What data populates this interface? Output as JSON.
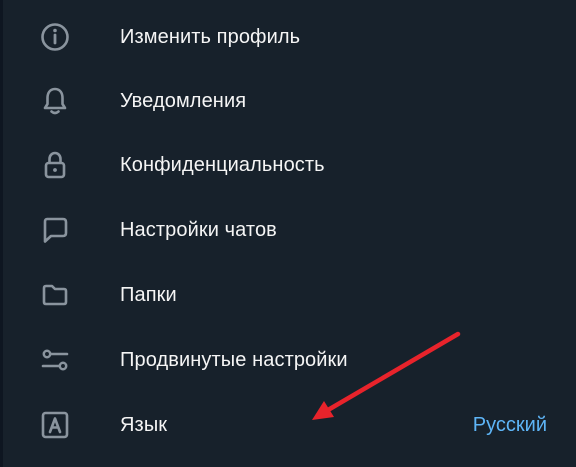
{
  "menu": {
    "items": [
      {
        "id": "edit-profile",
        "label": "Изменить профиль",
        "icon": "info-icon"
      },
      {
        "id": "notifications",
        "label": "Уведомления",
        "icon": "bell-icon"
      },
      {
        "id": "privacy",
        "label": "Конфиденциальность",
        "icon": "lock-icon"
      },
      {
        "id": "chat-settings",
        "label": "Настройки чатов",
        "icon": "chat-bubble-icon"
      },
      {
        "id": "folders",
        "label": "Папки",
        "icon": "folder-icon"
      },
      {
        "id": "advanced",
        "label": "Продвинутые настройки",
        "icon": "sliders-icon"
      },
      {
        "id": "language",
        "label": "Язык",
        "icon": "language-icon",
        "value": "Русский"
      }
    ]
  },
  "colors": {
    "background": "#17212b",
    "text": "#f5f5f5",
    "icon": "#8a949e",
    "accent": "#5eb5f7",
    "arrow": "#e8232b"
  }
}
